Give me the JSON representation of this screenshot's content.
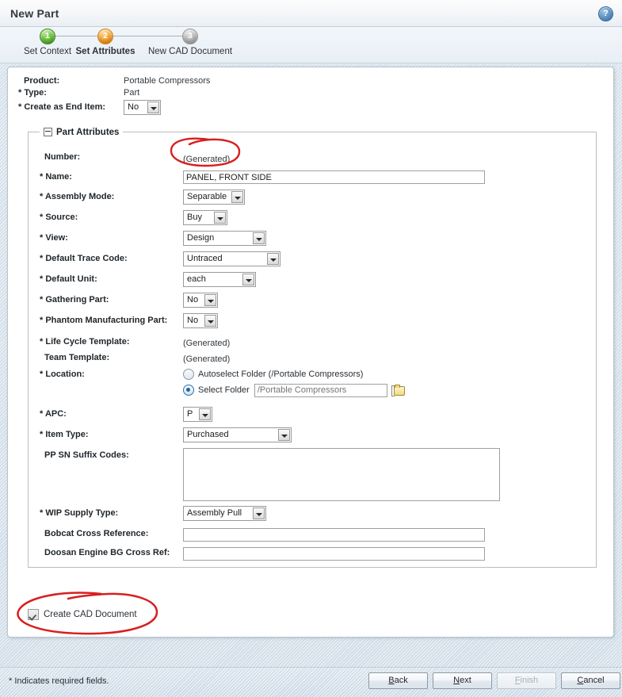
{
  "window": {
    "title": "New Part",
    "help_icon": "help-question-icon",
    "help_glyph": "?"
  },
  "wizard": {
    "steps": [
      {
        "number": "1",
        "label": "Set Context",
        "state": "done",
        "color": "#4fae2b"
      },
      {
        "number": "2",
        "label": "Set Attributes",
        "state": "current",
        "color": "#f09a1e"
      },
      {
        "number": "3",
        "label": "New CAD Document",
        "state": "upcoming",
        "color": "#b0b0b0"
      }
    ]
  },
  "header_fields": [
    {
      "label": "Product:",
      "required": false,
      "value": "Portable Compressors",
      "type": "static"
    },
    {
      "label": "Type:",
      "required": true,
      "value": "Part",
      "type": "static"
    },
    {
      "label": "Create as End Item:",
      "required": true,
      "value": "No",
      "type": "select"
    }
  ],
  "group": {
    "legend": "Part Attributes",
    "collapse_icon": "collapse-minus-icon"
  },
  "fields": [
    {
      "name": "number",
      "label": "Number:",
      "required": false,
      "type": "static",
      "value": "(Generated)"
    },
    {
      "name": "name",
      "label": "Name:",
      "required": true,
      "type": "text",
      "value": "PANEL, FRONT SIDE"
    },
    {
      "name": "assembly-mode",
      "label": "Assembly Mode:",
      "required": true,
      "type": "select",
      "value": "Separable"
    },
    {
      "name": "source",
      "label": "Source:",
      "required": true,
      "type": "select",
      "value": "Buy"
    },
    {
      "name": "view",
      "label": "View:",
      "required": true,
      "type": "select",
      "value": "Design"
    },
    {
      "name": "default-trace-code",
      "label": "Default Trace Code:",
      "required": true,
      "type": "select",
      "value": "Untraced"
    },
    {
      "name": "default-unit",
      "label": "Default Unit:",
      "required": true,
      "type": "select",
      "value": "each"
    },
    {
      "name": "gathering-part",
      "label": "Gathering Part:",
      "required": true,
      "type": "select",
      "value": "No"
    },
    {
      "name": "phantom-manufacturing-part",
      "label": "Phantom Manufacturing Part:",
      "required": true,
      "type": "select",
      "value": "No"
    },
    {
      "name": "life-cycle-template",
      "label": "Life Cycle Template:",
      "required": true,
      "type": "static",
      "value": "(Generated)"
    },
    {
      "name": "team-template",
      "label": "Team Template:",
      "required": false,
      "type": "static",
      "value": "(Generated)"
    }
  ],
  "location": {
    "label": "Location:",
    "required": true,
    "option_autoselect": "Autoselect Folder (/Portable Compressors)",
    "option_select": "Select Folder",
    "selected": "select",
    "folder_placeholder": "/Portable Compressors",
    "folder_value": "",
    "browse_icon": "folder-browse-icon"
  },
  "fields2": [
    {
      "name": "apc",
      "label": "APC:",
      "required": true,
      "type": "select",
      "value": "P"
    },
    {
      "name": "item-type",
      "label": "Item Type:",
      "required": true,
      "type": "select",
      "value": "Purchased"
    },
    {
      "name": "pp-sn-suffix-codes",
      "label": "PP SN Suffix Codes:",
      "required": false,
      "type": "textarea",
      "value": ""
    },
    {
      "name": "wip-supply-type",
      "label": "WIP Supply Type:",
      "required": true,
      "type": "select",
      "value": "Assembly Pull"
    },
    {
      "name": "bobcat-cross-reference",
      "label": "Bobcat Cross Reference:",
      "required": false,
      "type": "text",
      "value": ""
    },
    {
      "name": "doosan-engine-bg-cross-ref",
      "label": "Doosan Engine BG Cross Ref:",
      "required": false,
      "type": "text",
      "value": ""
    }
  ],
  "cad": {
    "label": "Create CAD Document",
    "checked": true
  },
  "footer": {
    "required_note": "* Indicates required fields.",
    "buttons": [
      {
        "name": "back",
        "label": "Back",
        "mnemonic": "B",
        "disabled": false
      },
      {
        "name": "next",
        "label": "Next",
        "mnemonic": "N",
        "disabled": false
      },
      {
        "name": "finish",
        "label": "Finish",
        "mnemonic": "F",
        "disabled": true
      },
      {
        "name": "cancel",
        "label": "Cancel",
        "mnemonic": "C",
        "disabled": false
      }
    ]
  },
  "annotations": {
    "color": "#d81f1f",
    "items": [
      {
        "name": "annotation-circle-number-generated",
        "target": "number-generated-value"
      },
      {
        "name": "annotation-circle-create-cad-document",
        "target": "create-cad-document-checkbox"
      }
    ]
  }
}
